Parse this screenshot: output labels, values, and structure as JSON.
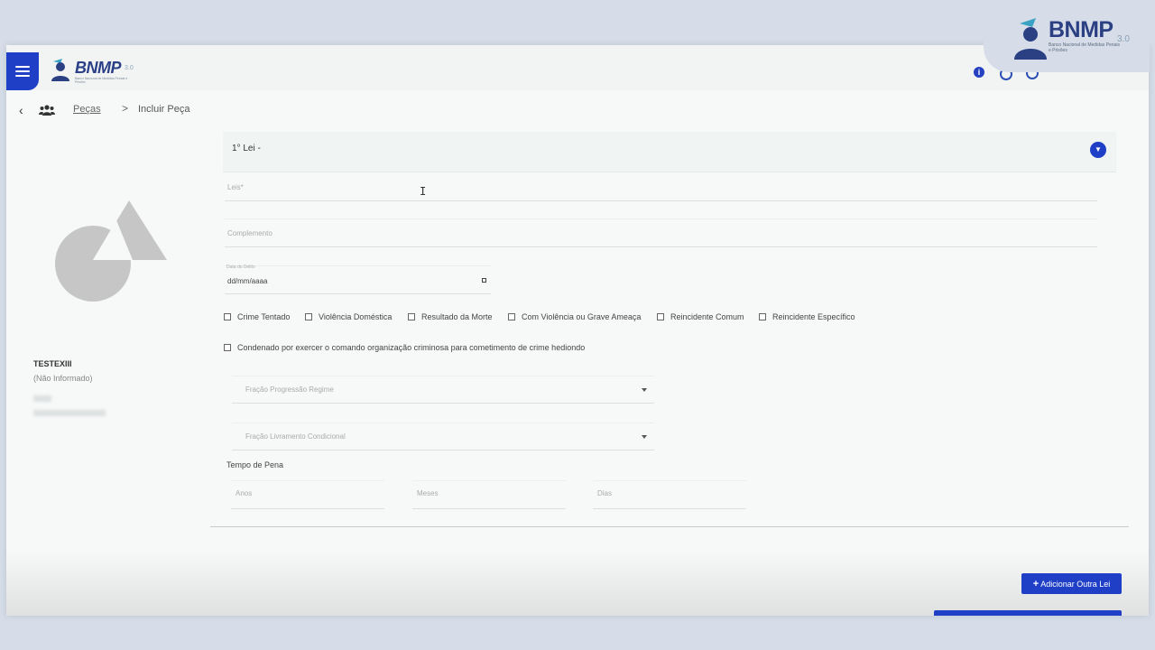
{
  "brand": {
    "name": "BNMP",
    "version": "3.0",
    "version_small": "3.0",
    "subtitle": "Banco Nacional de Medidas Penais e Prisões"
  },
  "breadcrumb": {
    "parent": "Peças",
    "separator": ">",
    "current": "Incluir Peça"
  },
  "person": {
    "name": "TESTEXIII",
    "subtitle": "(Não Informado)"
  },
  "lei_section": {
    "title": "1° Lei -"
  },
  "form": {
    "leis_label": "Leis*",
    "complemento_label": "Complemento",
    "data_delito_label": "Data do Delito",
    "data_delito_value": "dd/mm/aaaa",
    "checkboxes": [
      "Crime Tentado",
      "Violência Doméstica",
      "Resultado da Morte",
      "Com Violência ou Grave Ameaça",
      "Reincidente Comum",
      "Reincidente Específico"
    ],
    "condenado_label": "Condenado por exercer o comando organização criminosa para cometimento de crime hediondo",
    "fracao_progressao_placeholder": "Fração Progressão Regime",
    "fracao_livramento_placeholder": "Fração Livramento Condicional",
    "tempo_pena_label": "Tempo de Pena",
    "anos_placeholder": "Anos",
    "meses_placeholder": "Meses",
    "dias_placeholder": "Dias"
  },
  "actions": {
    "add_label": "Adicionar Outra Lei"
  },
  "colors": {
    "primary": "#1f3fc7",
    "brand_text": "#2b3f83",
    "background": "#d6dde9"
  }
}
